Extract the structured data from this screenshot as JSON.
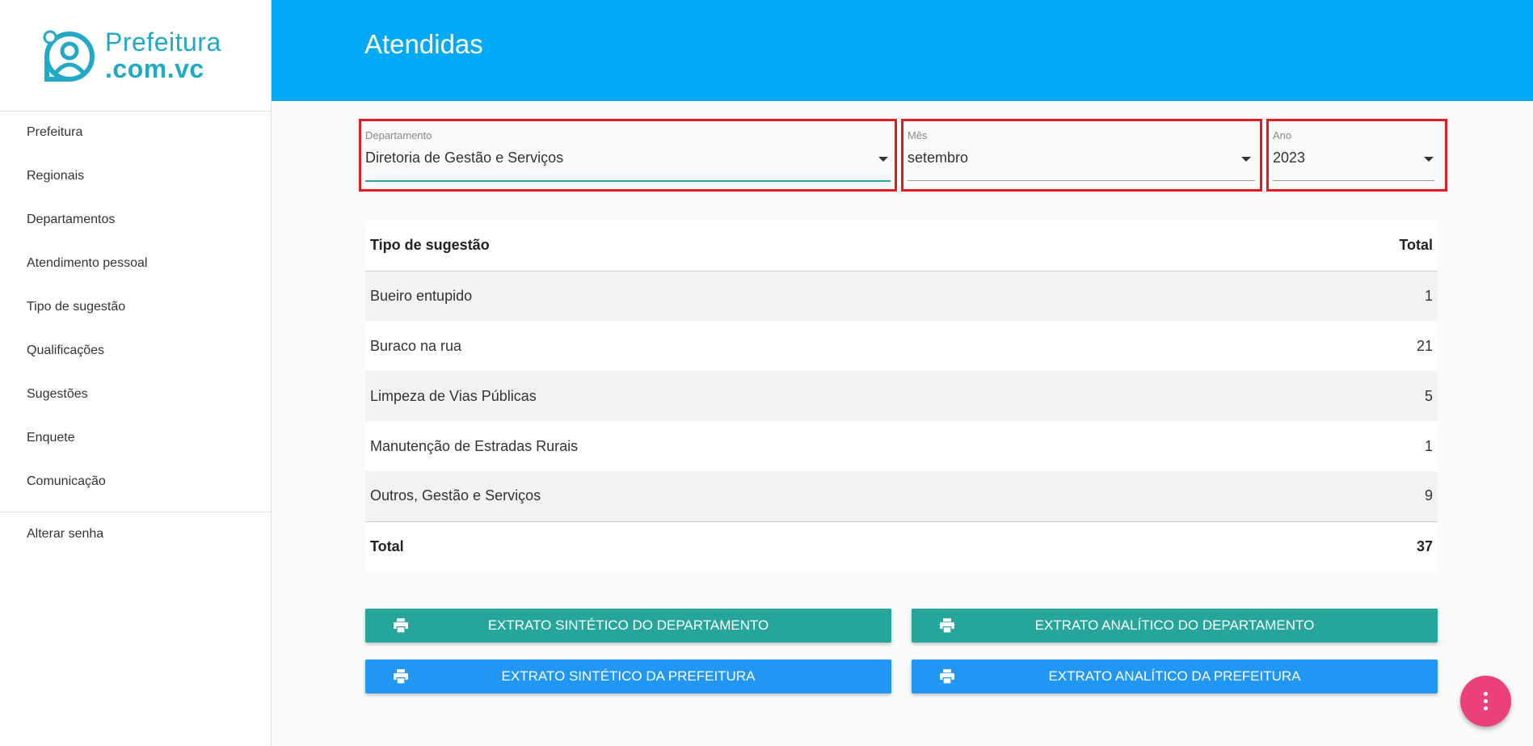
{
  "brand": {
    "line1": "Prefeitura",
    "line2": ".com.vc",
    "color": "#21a9c6"
  },
  "sidebar": {
    "items": [
      {
        "label": "Prefeitura"
      },
      {
        "label": "Regionais"
      },
      {
        "label": "Departamentos"
      },
      {
        "label": "Atendimento pessoal"
      },
      {
        "label": "Tipo de sugestão"
      },
      {
        "label": "Qualificações"
      },
      {
        "label": "Sugestões"
      },
      {
        "label": "Enquete"
      },
      {
        "label": "Comunicação"
      }
    ],
    "bottom_items": [
      {
        "label": "Alterar senha"
      }
    ]
  },
  "header": {
    "title": "Atendidas",
    "color": "#03a9f4"
  },
  "filters": {
    "departamento": {
      "label": "Departamento",
      "value": "Diretoria de Gestão e Serviços"
    },
    "mes": {
      "label": "Mês",
      "value": "setembro"
    },
    "ano": {
      "label": "Ano",
      "value": "2023"
    }
  },
  "table": {
    "headers": {
      "tipo": "Tipo de sugestão",
      "total": "Total"
    },
    "rows": [
      {
        "tipo": "Bueiro entupido",
        "total": "1"
      },
      {
        "tipo": "Buraco na rua",
        "total": "21"
      },
      {
        "tipo": "Limpeza de Vias Públicas",
        "total": "5"
      },
      {
        "tipo": "Manutenção de Estradas Rurais",
        "total": "1"
      },
      {
        "tipo": "Outros, Gestão e Serviços",
        "total": "9"
      }
    ],
    "footer": {
      "label": "Total",
      "value": "37"
    }
  },
  "buttons": {
    "sintetico_departamento": "EXTRATO SINTÉTICO DO DEPARTAMENTO",
    "analitico_departamento": "EXTRATO ANALÍTICO DO DEPARTAMENTO",
    "sintetico_prefeitura": "EXTRATO SINTÉTICO DA PREFEITURA",
    "analitico_prefeitura": "EXTRATO ANALÍTICO DA PREFEITURA"
  },
  "icons": {
    "print": "print-icon",
    "fab": "more-vertical-icon",
    "logo": "user-circle-logo"
  },
  "colors": {
    "teal": "#26a69a",
    "blue": "#2196f3",
    "fab": "#ec407a",
    "filter_highlight": "#e01b24"
  }
}
